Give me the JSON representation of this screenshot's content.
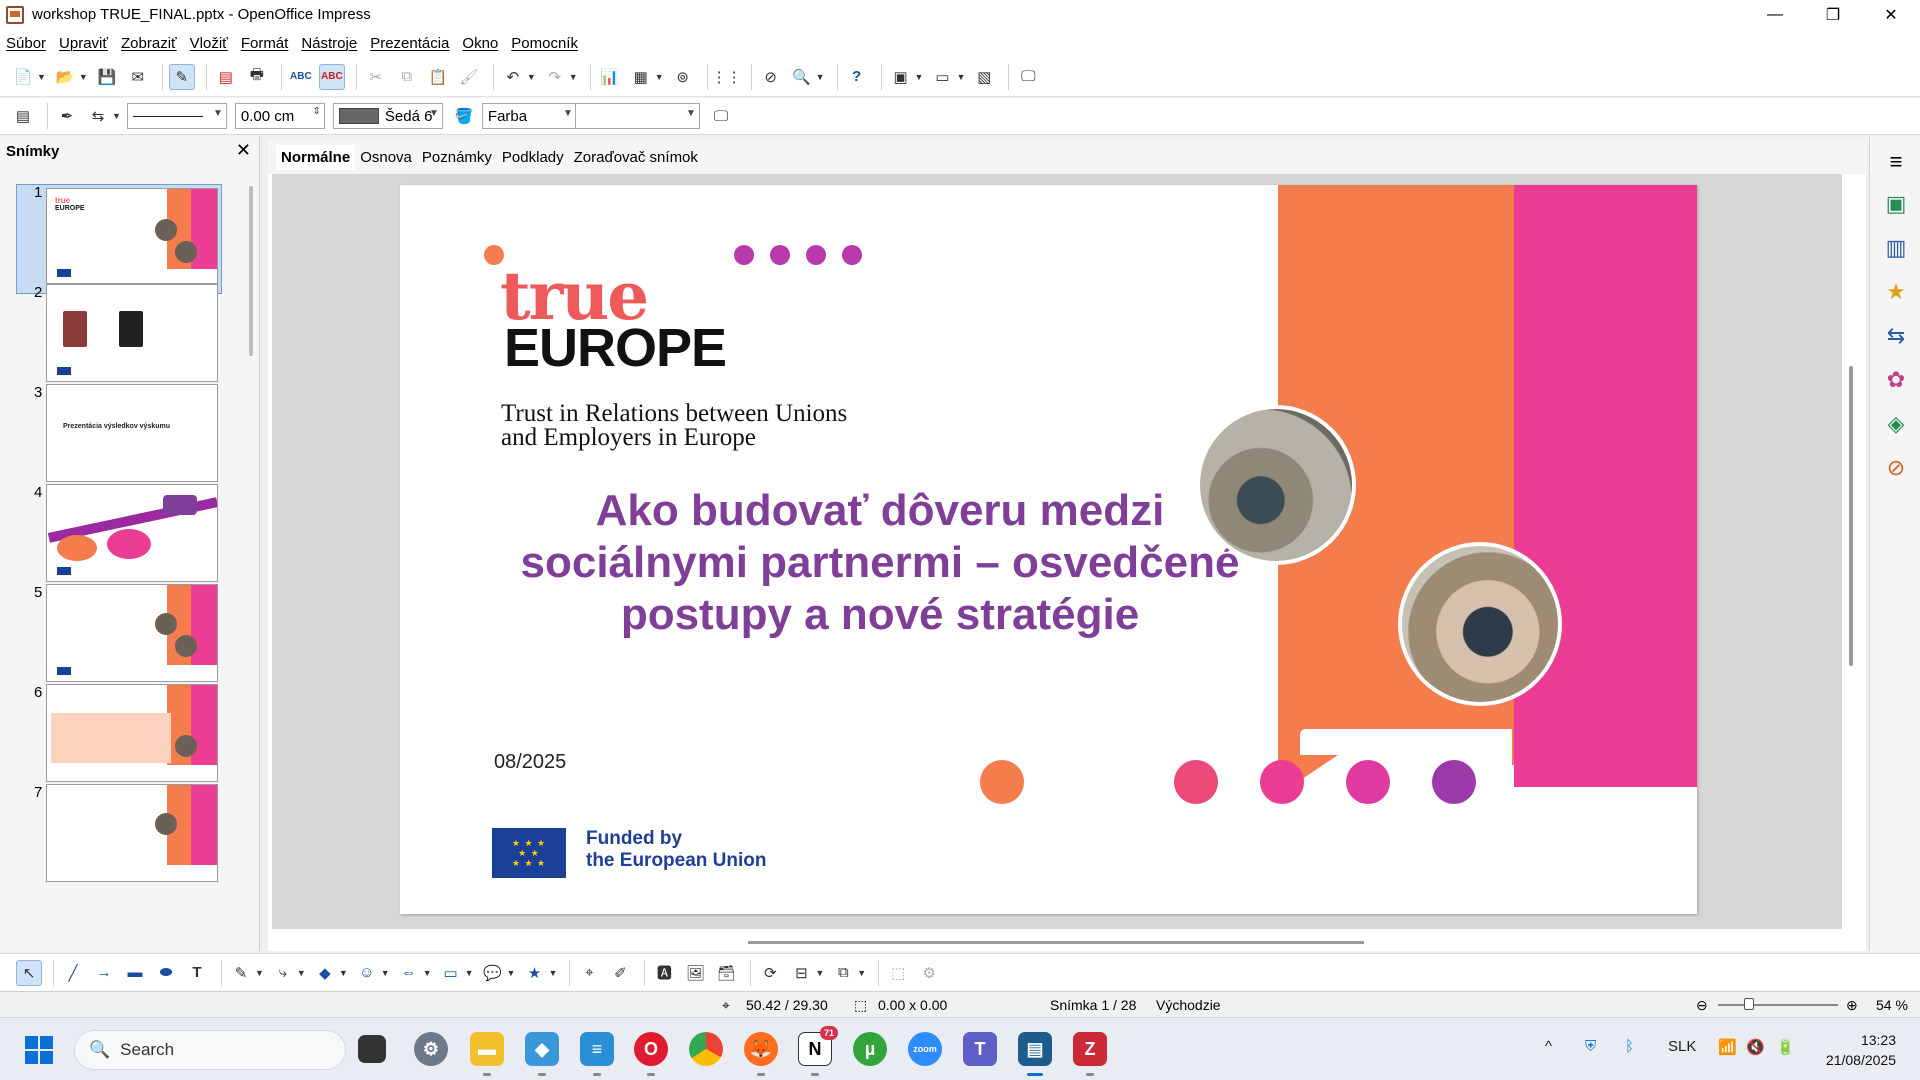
{
  "window": {
    "title": "workshop TRUE_FINAL.pptx - OpenOffice Impress",
    "controls": [
      "—",
      "❐",
      "✕"
    ]
  },
  "menu": [
    "Súbor",
    "Upraviť",
    "Zobraziť",
    "Vložiť",
    "Formát",
    "Nástroje",
    "Prezentácia",
    "Okno",
    "Pomocník"
  ],
  "toolbar2": {
    "line_width": "0.00 cm",
    "fill_color": "Šedá 6",
    "fill_type": "Farba",
    "fill_value": ""
  },
  "slides_pane": {
    "title": "Snímky",
    "thumbnails": [
      {
        "num": "1",
        "text": ""
      },
      {
        "num": "2",
        "text": ""
      },
      {
        "num": "3",
        "text": "Prezentácia výsledkov výskumu"
      },
      {
        "num": "4",
        "text": ""
      },
      {
        "num": "5",
        "text": ""
      },
      {
        "num": "6",
        "text": ""
      },
      {
        "num": "7",
        "text": ""
      }
    ]
  },
  "view_tabs": [
    "Normálne",
    "Osnova",
    "Poznámky",
    "Podklady",
    "Zoraďovač snímok"
  ],
  "slide": {
    "logo_top": "true",
    "logo_bottom": "EUROPE",
    "subtitle": "Trust in Relations between Unions and Employers in Europe",
    "title": "Ako budovať dôveru medzi sociálnymi partnermi – osvedčené postupy a nové stratégie",
    "date": "08/2025",
    "eu_funding_line1": "Funded by",
    "eu_funding_line2": "the European Union",
    "colors": {
      "orange": "#f47c4d",
      "pink": "#ea3d93",
      "purple": "#7f3f98",
      "eu_blue": "#1c3f97"
    }
  },
  "status": {
    "position": "50.42 / 29.30",
    "size": "0.00 x 0.00",
    "slide": "Snímka 1 / 28",
    "layout": "Východzie",
    "zoom": "54 %"
  },
  "taskbar": {
    "search_placeholder": "Search",
    "notion_badge": "71",
    "language": "SLK",
    "time": "13:23",
    "date": "21/08/2025"
  }
}
